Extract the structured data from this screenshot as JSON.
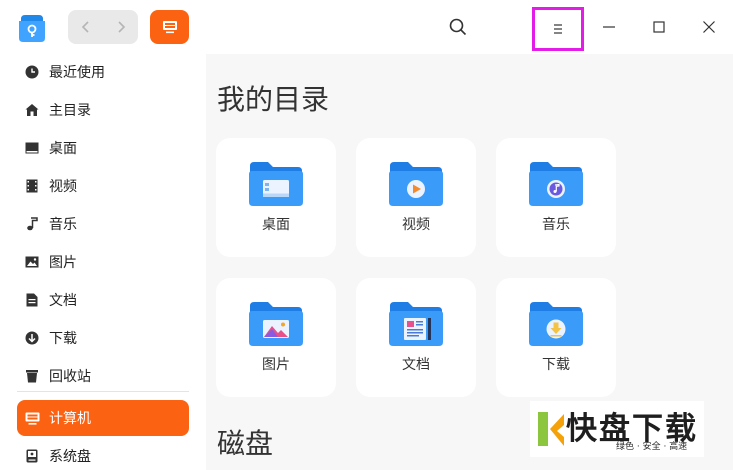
{
  "sidebar": {
    "items": [
      {
        "label": "最近使用",
        "icon": "clock-icon"
      },
      {
        "label": "主目录",
        "icon": "home-icon"
      },
      {
        "label": "桌面",
        "icon": "desktop-icon"
      },
      {
        "label": "视频",
        "icon": "video-icon"
      },
      {
        "label": "音乐",
        "icon": "music-icon"
      },
      {
        "label": "图片",
        "icon": "picture-icon"
      },
      {
        "label": "文档",
        "icon": "document-icon"
      },
      {
        "label": "下载",
        "icon": "download-icon"
      },
      {
        "label": "回收站",
        "icon": "trash-icon"
      },
      {
        "label": "计算机",
        "icon": "computer-icon",
        "active": true
      },
      {
        "label": "系统盘",
        "icon": "disk-icon"
      }
    ]
  },
  "main": {
    "section_title": "我的目录",
    "disk_section_title": "磁盘",
    "folders": [
      {
        "label": "桌面",
        "icon": "desktop-folder-icon"
      },
      {
        "label": "视频",
        "icon": "video-folder-icon"
      },
      {
        "label": "音乐",
        "icon": "music-folder-icon"
      },
      {
        "label": "图片",
        "icon": "picture-folder-icon"
      },
      {
        "label": "文档",
        "icon": "document-folder-icon"
      },
      {
        "label": "下载",
        "icon": "download-folder-icon"
      }
    ]
  },
  "watermark": {
    "main": "快盘下载",
    "sub": "绿色 · 安全 · 高速"
  },
  "colors": {
    "accent": "#fb6212",
    "folder": "#2f8ef5",
    "highlight": "#e31ce8"
  }
}
